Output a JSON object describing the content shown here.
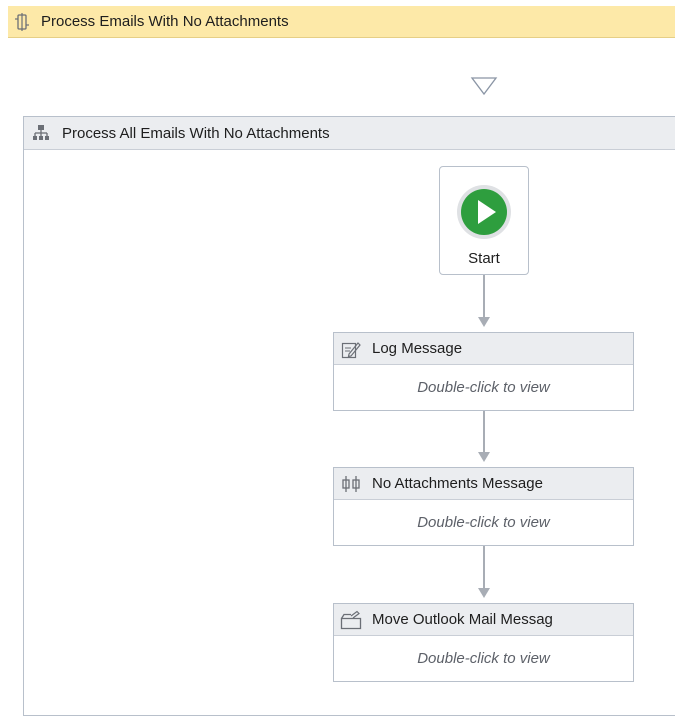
{
  "sequence": {
    "title": "Process Emails With No Attachments",
    "icon": "sequence-icon"
  },
  "flowchart": {
    "title": "Process All Emails With No Attachments",
    "icon": "flowchart-icon",
    "start": {
      "label": "Start",
      "icon": "play-icon",
      "accent_color": "#2e9e3e"
    },
    "activities": [
      {
        "title": "Log Message",
        "hint": "Double-click to view",
        "icon": "log-message-icon"
      },
      {
        "title": "No Attachments Message",
        "hint": "Double-click to view",
        "icon": "assign-icon"
      },
      {
        "title": "Move Outlook Mail Messag",
        "hint": "Double-click to view",
        "icon": "move-mail-icon"
      }
    ]
  },
  "colors": {
    "sequence_header": "#fde9a8",
    "activity_header": "#ebedf0",
    "connector": "#a8adb5"
  }
}
